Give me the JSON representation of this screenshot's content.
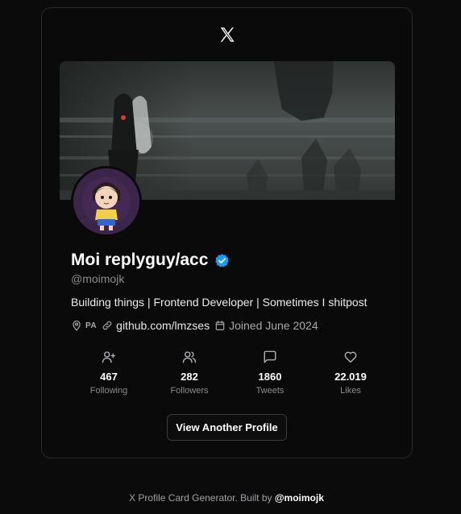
{
  "brand": {
    "logo_icon": "x-logo-icon"
  },
  "profile": {
    "name": "Moi replyguy/acc",
    "verified_icon": "verified-badge-icon",
    "handle": "@moimojk",
    "bio": "Building things | Frontend Developer | Sometimes I shitpost",
    "location": "PA",
    "website": "github.com/lmzses",
    "joined": "Joined June 2024"
  },
  "stats": [
    {
      "icon": "user-plus-icon",
      "value": "467",
      "label": "Following"
    },
    {
      "icon": "users-icon",
      "value": "282",
      "label": "Followers"
    },
    {
      "icon": "message-square-icon",
      "value": "1860",
      "label": "Tweets"
    },
    {
      "icon": "heart-icon",
      "value": "22.019",
      "label": "Likes"
    }
  ],
  "actions": {
    "view_another": "View Another Profile"
  },
  "footer": {
    "prefix": "X Profile Card Generator. Built by ",
    "author": "@moimojk"
  },
  "colors": {
    "background": "#0b0b0c",
    "card": "#0a0a0a",
    "border": "#2b2b2e",
    "verified": "#1d9bf0",
    "muted": "#8b8b90"
  }
}
